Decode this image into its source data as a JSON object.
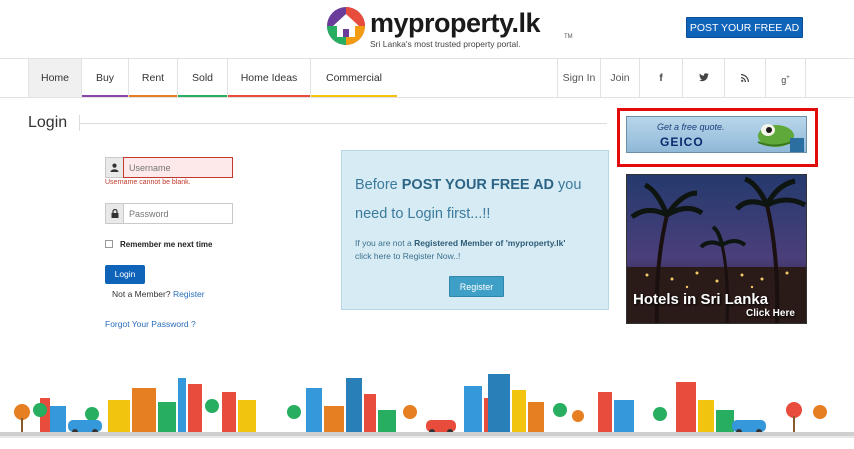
{
  "header": {
    "logo_text": "myproperty.lk",
    "logo_tm": "TM",
    "tagline": "Sri Lanka's most trusted property portal.",
    "post_ad_label": "POST YOUR FREE AD"
  },
  "nav": {
    "items": [
      {
        "label": "Home",
        "color": "#ffffff"
      },
      {
        "label": "Buy",
        "color": "#8e44ad"
      },
      {
        "label": "Rent",
        "color": "#e67e22"
      },
      {
        "label": "Sold",
        "color": "#27ae60"
      },
      {
        "label": "Home Ideas",
        "color": "#e74c3c"
      },
      {
        "label": "Commercial",
        "color": "#f1c40f"
      }
    ],
    "sign_in": "Sign In",
    "join": "Join",
    "social_icons": [
      "facebook-icon",
      "twitter-icon",
      "rss-icon",
      "google-plus-icon"
    ]
  },
  "login": {
    "title": "Login",
    "username_placeholder": "Username",
    "username_error": "Username cannot be blank.",
    "password_placeholder": "Password",
    "remember_label": "Remember me next time",
    "login_button": "Login",
    "not_member": "Not a Member?",
    "register_link": "Register",
    "forgot_link": "Forgot Your Password ?"
  },
  "info": {
    "line1_pre": "Before ",
    "line1_bold": "POST YOUR FREE AD",
    "line1_post": " you",
    "line2": "need to Login first...!!",
    "sub_pre": "If you are not a ",
    "sub_bold1": "Registered Member of 'myproperty.lk'",
    "sub_post": "click here to Register Now..!",
    "register_button": "Register"
  },
  "ads": {
    "geico_quote": "Get a free quote.",
    "geico_brand": "GEICO",
    "hotel_text": "Hotels in Sri Lanka",
    "hotel_click": "Click Here"
  },
  "colors": {
    "brand_blue": "#0f64b9",
    "error_red": "#c0392b",
    "info_bg": "#d6ebf4"
  }
}
